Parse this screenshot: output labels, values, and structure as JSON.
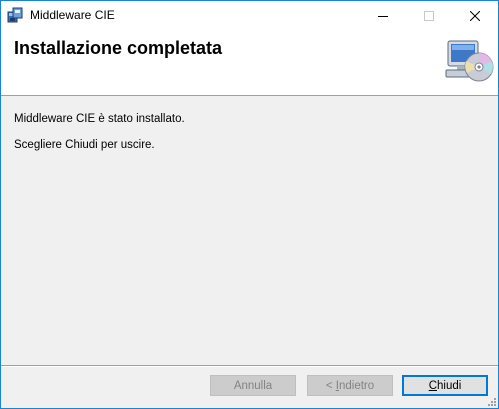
{
  "window": {
    "title": "Middleware CIE",
    "app_icon": "installer-icon"
  },
  "titlebar_buttons": {
    "minimize_icon": "minimize-icon",
    "maximize_icon": "maximize-icon",
    "close_icon": "close-icon"
  },
  "header": {
    "title": "Installazione completata",
    "icon": "computer-cd-icon"
  },
  "content": {
    "line1": "Middleware CIE è stato installato.",
    "line2": "Scegliere Chiudi per uscire."
  },
  "buttons": {
    "cancel": {
      "label": "Annulla",
      "enabled": false
    },
    "back": {
      "prefix": "< ",
      "accel": "I",
      "rest": "ndietro",
      "enabled": false
    },
    "close": {
      "accel": "C",
      "rest": "hiudi",
      "enabled": true,
      "default": true
    }
  },
  "colors": {
    "window_border": "#1883d7",
    "header_bg": "#ffffff",
    "body_bg": "#f0f0f0",
    "default_button_border": "#0078d7",
    "disabled_text": "#838383"
  }
}
